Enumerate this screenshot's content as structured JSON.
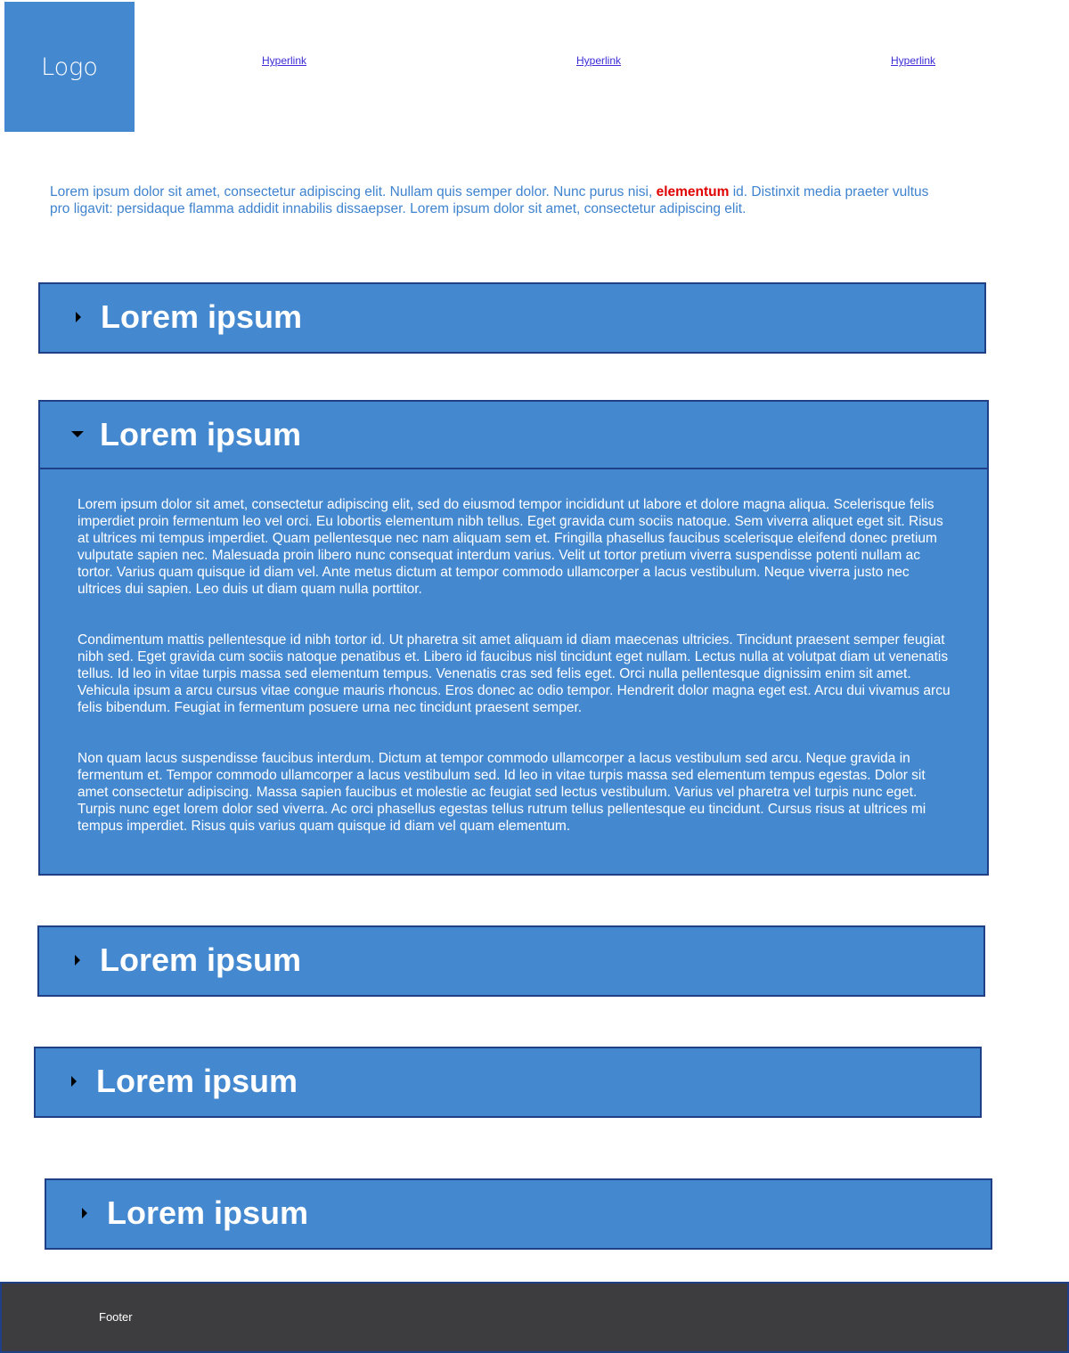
{
  "header": {
    "logo_text": "Logo",
    "links": [
      "Hyperlink",
      "Hyperlink",
      "Hyperlink"
    ]
  },
  "intro": {
    "before": "Lorem ipsum dolor sit amet, consectetur adipiscing elit. Nullam quis semper dolor. Nunc purus nisi, ",
    "highlight": "elementum",
    "after": " id. Distinxit  media praeter vultus pro ligavit: persidaque flamma addidit innabilis dissaepser. Lorem ipsum dolor sit amet, consectetur adipiscing elit."
  },
  "accordion": [
    {
      "title": "Lorem ipsum",
      "expanded": false
    },
    {
      "title": "Lorem ipsum",
      "expanded": true,
      "paragraphs": [
        "Lorem ipsum dolor sit amet, consectetur adipiscing elit, sed do eiusmod tempor incididunt ut labore et dolore magna aliqua. Scelerisque felis imperdiet proin fermentum leo vel orci. Eu lobortis elementum nibh tellus. Eget gravida cum sociis natoque. Sem viverra aliquet eget sit. Risus at ultrices mi tempus imperdiet. Quam pellentesque nec nam aliquam sem et. Fringilla phasellus faucibus scelerisque eleifend donec pretium vulputate sapien nec. Malesuada proin libero nunc consequat interdum varius. Velit ut tortor pretium viverra suspendisse potenti nullam ac tortor. Varius quam quisque id diam vel. Ante metus dictum at tempor commodo ullamcorper a lacus vestibulum. Neque viverra justo nec ultrices dui sapien. Leo duis ut diam quam nulla porttitor.",
        "Condimentum mattis pellentesque id nibh tortor id. Ut pharetra sit amet aliquam id diam maecenas ultricies. Tincidunt praesent semper feugiat nibh sed. Eget gravida cum sociis natoque penatibus et. Libero id faucibus nisl tincidunt eget nullam. Lectus nulla at volutpat diam ut venenatis tellus. Id leo in vitae turpis massa sed elementum tempus. Venenatis cras sed felis eget. Orci nulla pellentesque dignissim enim sit amet. Vehicula ipsum a arcu cursus vitae congue mauris rhoncus. Eros donec ac odio tempor. Hendrerit dolor magna eget est. Arcu dui vivamus arcu felis bibendum. Feugiat in fermentum posuere urna nec tincidunt praesent semper.",
        "Non quam lacus suspendisse faucibus interdum. Dictum at tempor commodo ullamcorper a lacus vestibulum sed arcu. Neque gravida in fermentum et. Tempor commodo ullamcorper a lacus vestibulum sed. Id leo in vitae turpis massa sed elementum tempus egestas. Dolor sit amet consectetur adipiscing. Massa sapien faucibus et molestie ac feugiat sed lectus vestibulum. Varius vel pharetra vel turpis nunc eget. Turpis nunc eget lorem dolor sed viverra. Ac orci phasellus egestas tellus rutrum tellus pellentesque eu tincidunt. Cursus risus at ultrices mi tempus imperdiet. Risus quis varius quam quisque id diam vel quam elementum."
      ]
    },
    {
      "title": "Lorem ipsum",
      "expanded": false
    },
    {
      "title": "Lorem ipsum",
      "expanded": false
    },
    {
      "title": "Lorem ipsum",
      "expanded": false
    }
  ],
  "footer": {
    "text": "Footer"
  },
  "colors": {
    "accent": "#4488d0",
    "border": "#1f3f86",
    "intro_text": "#3f83cf",
    "highlight": "#e00000",
    "link": "#3b2cd6",
    "footer_bg": "#3d3d3f"
  }
}
